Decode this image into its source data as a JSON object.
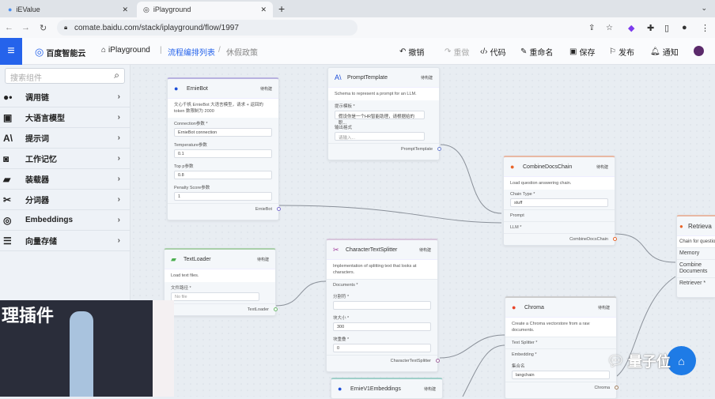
{
  "browser": {
    "tabs": [
      {
        "label": "iEValue"
      },
      {
        "label": "iPlayground",
        "active": true
      }
    ],
    "url": "comate.baidu.com/stack/iplayground/flow/1997"
  },
  "header": {
    "brand": "百度智能云",
    "app": "iPlayground",
    "breadcrumb": [
      "流程编排列表",
      "休假政策"
    ],
    "actions": [
      {
        "icon": "undo-icon",
        "label": "撤销"
      },
      {
        "icon": "redo-icon",
        "label": "重做"
      },
      {
        "icon": "code-icon",
        "label": "代码"
      },
      {
        "icon": "edit-icon",
        "label": "重命名"
      },
      {
        "icon": "save-icon",
        "label": "保存"
      },
      {
        "icon": "publish-icon",
        "label": "发布"
      },
      {
        "icon": "bell-icon",
        "label": "通知"
      }
    ]
  },
  "sidebar": {
    "search_placeholder": "搜索组件",
    "items": [
      {
        "label": "调用链",
        "icon": "chain-icon"
      },
      {
        "label": "大语言模型",
        "icon": "llm-icon"
      },
      {
        "label": "提示词",
        "icon": "prompt-icon"
      },
      {
        "label": "工作记忆",
        "icon": "memory-icon"
      },
      {
        "label": "装载器",
        "icon": "loader-icon"
      },
      {
        "label": "分词器",
        "icon": "scissors-icon"
      },
      {
        "label": "Embeddings",
        "icon": "fingerprint-icon"
      },
      {
        "label": "向量存储",
        "icon": "database-icon"
      }
    ]
  },
  "nodes": {
    "erniebot": {
      "title": "ErnieBot",
      "badge": "待构建",
      "desc": "文心千帆 ErnieBot 大语言模型，请求 + 返回的 token 数限制为 2000",
      "conn_label": "Connection参数 *",
      "conn_value": "ErnieBot connection",
      "temp_label": "Temperature参数",
      "temp_value": "0.1",
      "topp_label": "Top p参数",
      "topp_value": "0.8",
      "penalty_label": "Penalty Score参数",
      "penalty_value": "1",
      "output": "ErnieBot"
    },
    "prompt": {
      "title": "PromptTemplate",
      "badge": "待构建",
      "desc": "Schema to represent a prompt for an LLM.",
      "tpl_label": "提示模板 *",
      "tpl_value": "假设你是一个HR智能助理，请根据给的职...",
      "fmt_label": "输出格式",
      "fmt_placeholder": "请输入...",
      "output": "PromptTemplate"
    },
    "combine": {
      "title": "CombineDocsChain",
      "badge": "待构建",
      "desc": "Load question answering chain.",
      "type_label": "Chain Type *",
      "type_value": "stuff",
      "in1": "Prompt",
      "in2": "LLM *",
      "output": "CombineDocsChain"
    },
    "retrieval": {
      "title": "Retrieva",
      "desc": "Chain for question",
      "in1": "Memory",
      "in2": "Combine Documents",
      "in3": "Retriever *"
    },
    "textloader": {
      "title": "TextLoader",
      "badge": "待构建",
      "desc": "Load text files.",
      "file_label": "文件路径 *",
      "file_value": "No file",
      "output": "TextLoader"
    },
    "splitter": {
      "title": "CharacterTextSplitter",
      "badge": "待构建",
      "desc": "Implementation of splitting text that looks at characters.",
      "in1": "Documents *",
      "sep_label": "分割符 *",
      "sep_value": "",
      "size_label": "块大小 *",
      "size_value": "300",
      "overlap_label": "块重叠 *",
      "overlap_value": "0",
      "output": "CharacterTextSplitter"
    },
    "chroma": {
      "title": "Chroma",
      "badge": "待构建",
      "desc": "Create a Chroma vectorstore from a raw documents.",
      "in1": "Text Splitter *",
      "in2": "Embedding *",
      "coll_label": "集合名",
      "coll_value": "langchain",
      "output": "Chroma"
    },
    "embeddings": {
      "title": "ErnieV1Embeddings",
      "badge": "待构建"
    }
  },
  "overlay": {
    "caption": "理插件",
    "watermark": "量子位"
  }
}
